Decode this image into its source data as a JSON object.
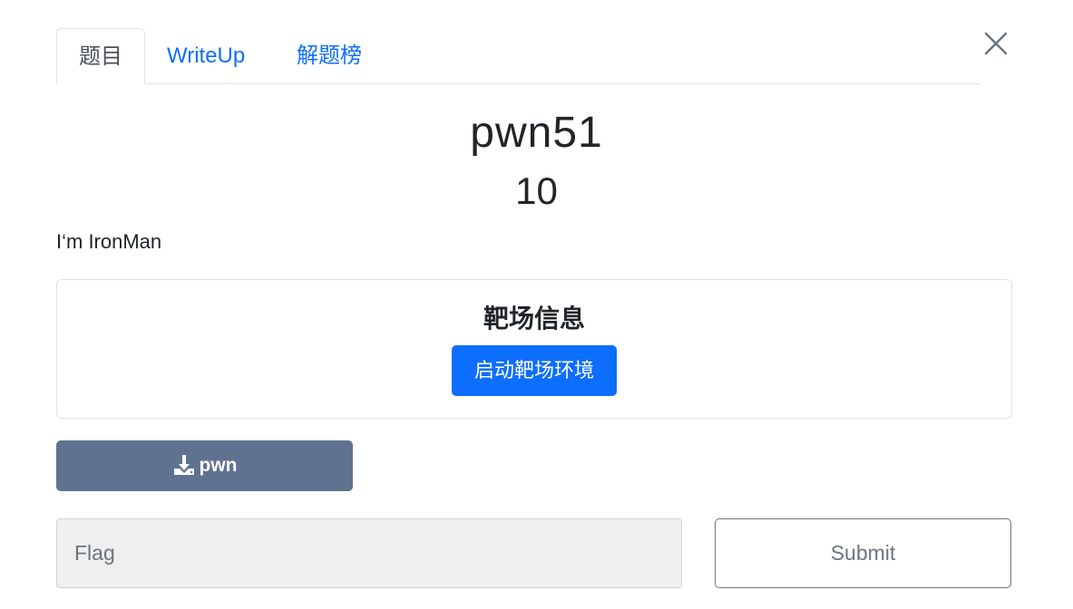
{
  "tabs": {
    "challenge": "题目",
    "writeup": "WriteUp",
    "solves": "解题榜"
  },
  "challenge": {
    "name": "pwn51",
    "points": "10",
    "description": "I‘m IronMan"
  },
  "environment": {
    "title": "靶场信息",
    "start_label": "启动靶场环境"
  },
  "download": {
    "label": "pwn",
    "icon": "download-icon"
  },
  "flag_form": {
    "placeholder": "Flag",
    "value": "",
    "submit_label": "Submit"
  },
  "colors": {
    "primary": "#0d6efd",
    "download_button": "#5f7290",
    "input_background": "#efefef",
    "secondary": "#6c757d"
  }
}
